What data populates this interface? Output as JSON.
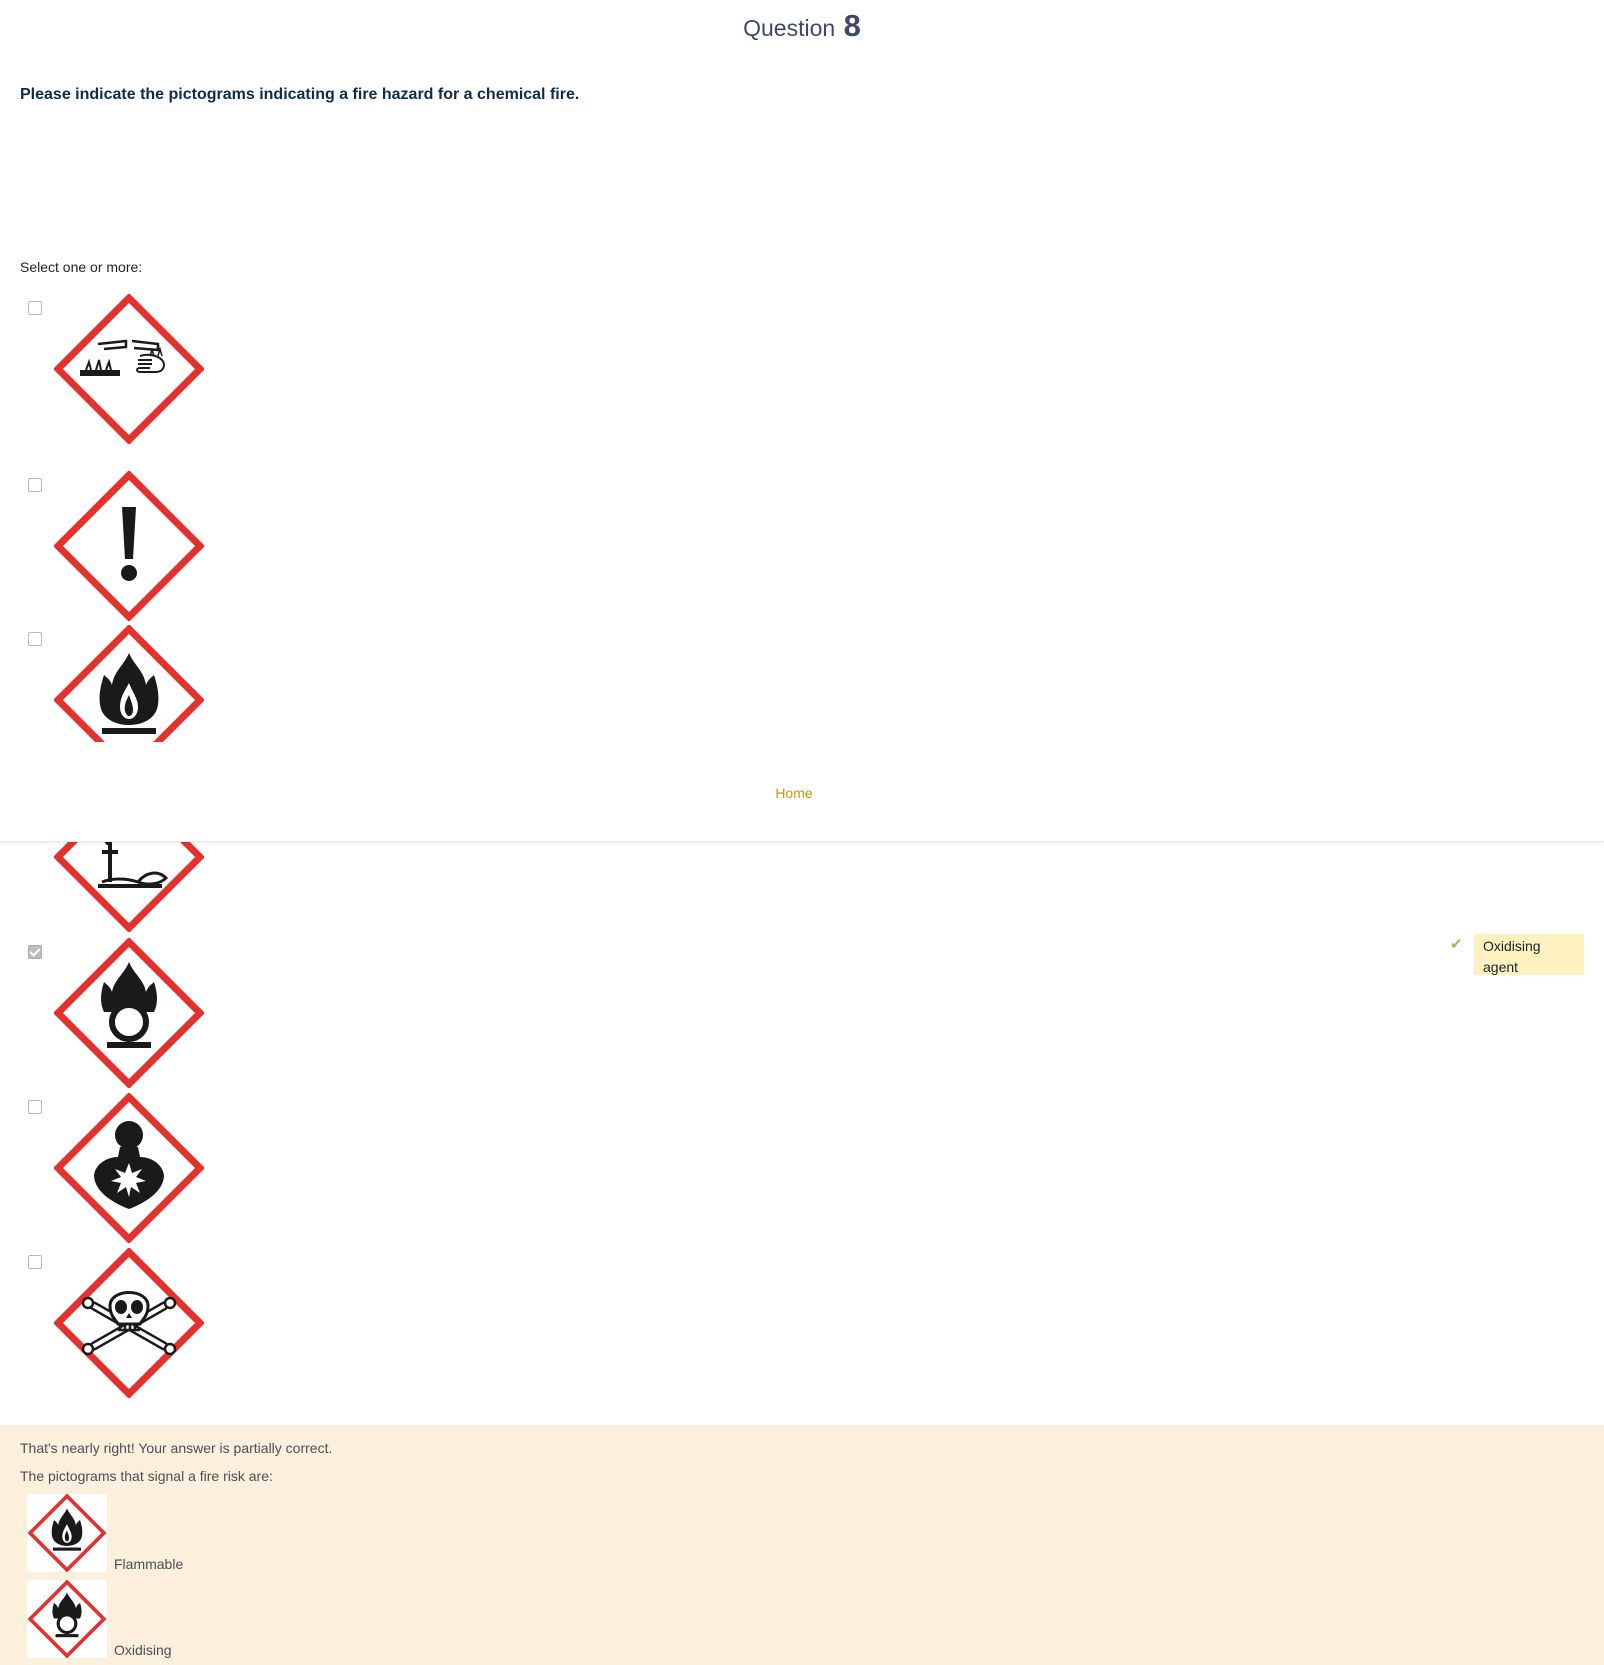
{
  "question": {
    "label": "Question",
    "number": "8"
  },
  "question_text": "Please indicate the pictograms indicating a fire hazard for a chemical fire.",
  "prompt": "Select one or more:",
  "options": [
    {
      "icon": "corrosive-pictogram-icon",
      "checked": false
    },
    {
      "icon": "exclamation-pictogram-icon",
      "checked": false
    },
    {
      "icon": "flammable-pictogram-icon",
      "checked": false
    },
    {
      "icon": "environment-pictogram-icon",
      "checked": false
    },
    {
      "icon": "oxidising-pictogram-icon",
      "checked": true
    },
    {
      "icon": "health-hazard-pictogram-icon",
      "checked": false
    },
    {
      "icon": "toxic-pictogram-icon",
      "checked": false
    }
  ],
  "inline_feedback": {
    "text": "Oxidising agent",
    "icon": "check-icon"
  },
  "nav": {
    "home": "Home"
  },
  "feedback": {
    "summary": "That's nearly right! Your answer is partially correct.",
    "intro": "The pictograms that signal a fire risk are:",
    "items": [
      {
        "label": "Flammable",
        "icon": "flammable-pictogram-icon"
      },
      {
        "label": "Oxidising",
        "icon": "oxidising-pictogram-icon"
      }
    ]
  },
  "colors": {
    "accent_red": "#e3312d",
    "link_gold": "#c6960c",
    "feedback_bg": "#fcefdc",
    "correct_bg": "#fcf1bf"
  }
}
